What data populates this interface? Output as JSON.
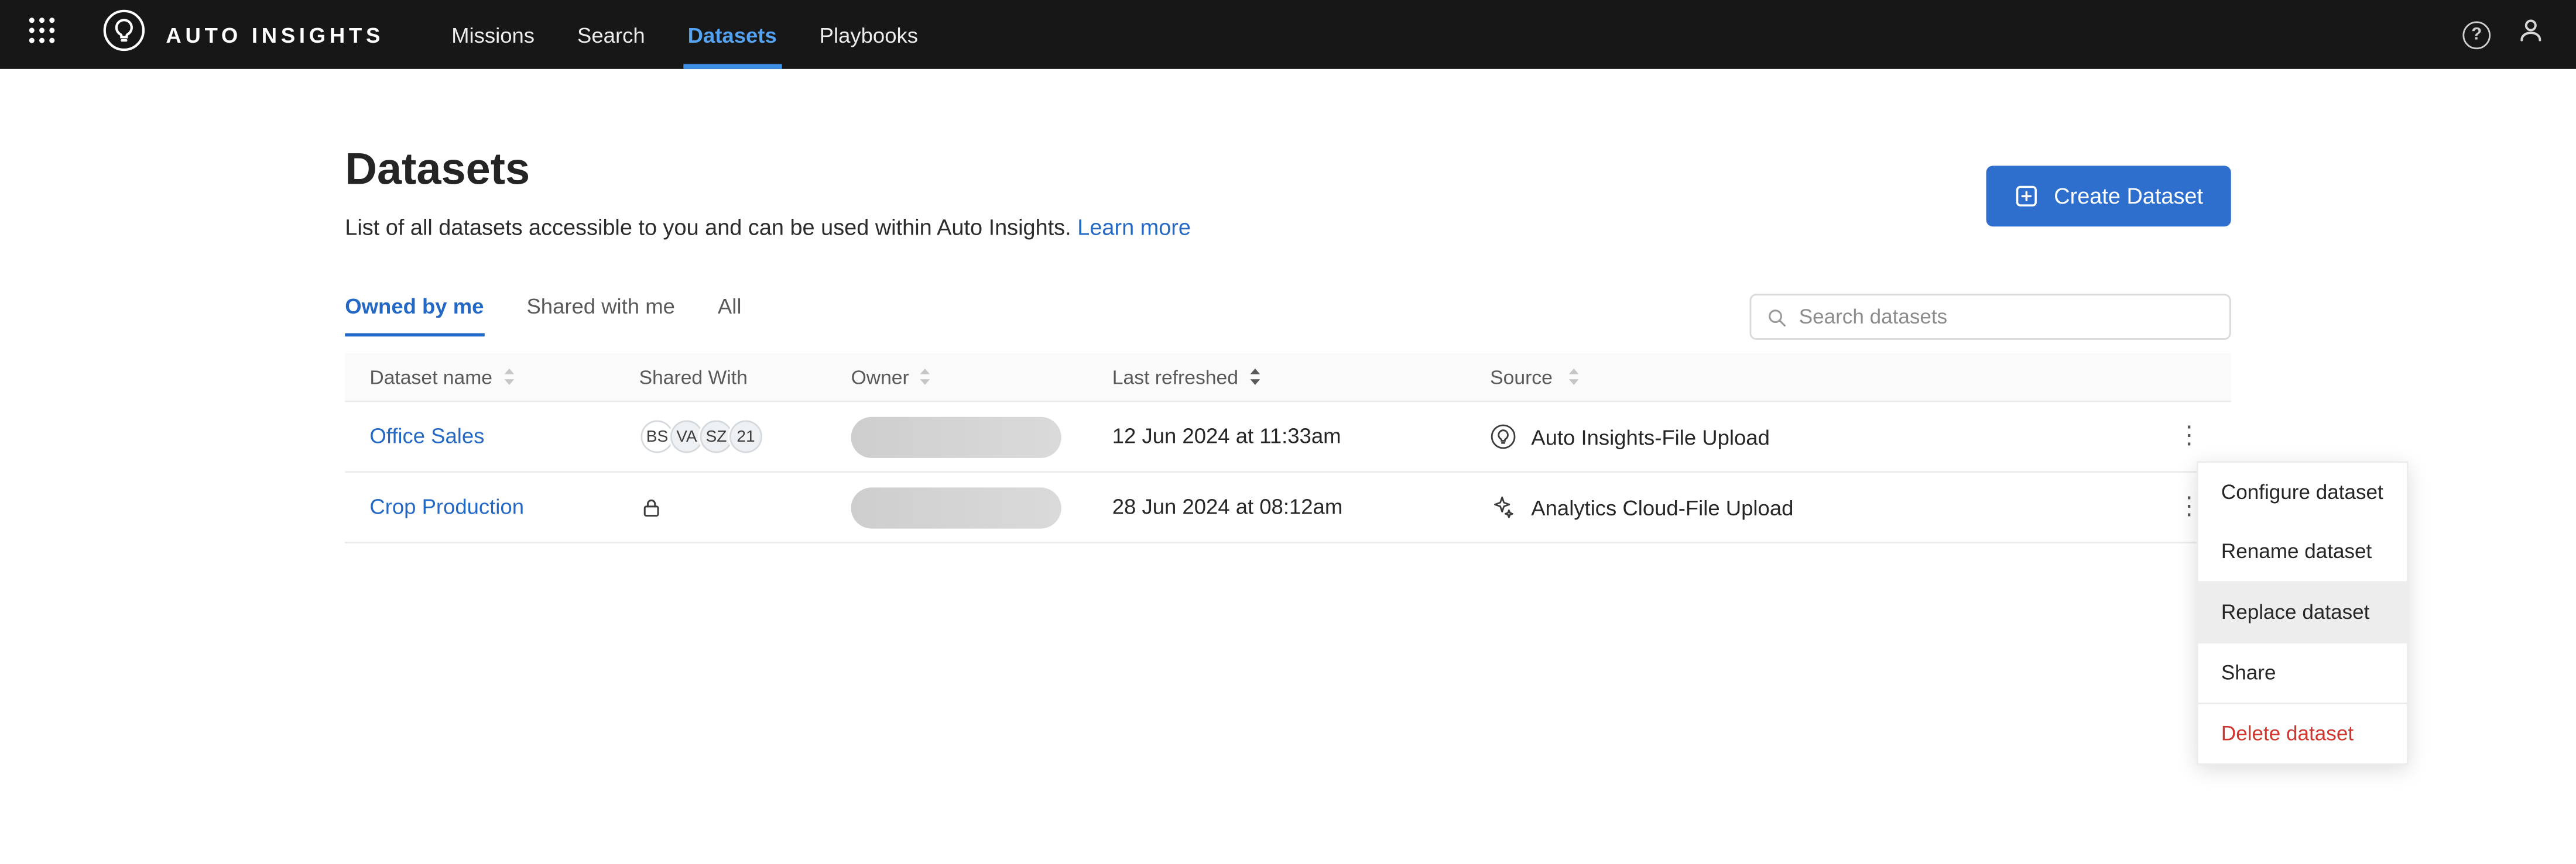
{
  "topbar": {
    "brand": "AUTO INSIGHTS",
    "nav": [
      {
        "label": "Missions",
        "active": false
      },
      {
        "label": "Search",
        "active": false
      },
      {
        "label": "Datasets",
        "active": true
      },
      {
        "label": "Playbooks",
        "active": false
      }
    ]
  },
  "header": {
    "title": "Datasets",
    "subtitle": "List of all datasets accessible to you and can be used within Auto Insights.",
    "learn_more": "Learn more",
    "create_button": "Create Dataset"
  },
  "tabs": [
    {
      "label": "Owned by me",
      "active": true
    },
    {
      "label": "Shared with me",
      "active": false
    },
    {
      "label": "All",
      "active": false
    }
  ],
  "search": {
    "placeholder": "Search datasets"
  },
  "table": {
    "columns": [
      "Dataset name",
      "Shared With",
      "Owner",
      "Last refreshed",
      "Source"
    ],
    "rows": [
      {
        "name": "Office Sales",
        "shared_with": {
          "type": "avatars",
          "avatars": [
            "BS",
            "VA",
            "SZ",
            "21"
          ]
        },
        "last_refreshed": "12 Jun 2024 at 11:33am",
        "source": "Auto Insights-File Upload",
        "source_icon": "auto-insights-icon"
      },
      {
        "name": "Crop Production",
        "shared_with": {
          "type": "lock"
        },
        "last_refreshed": "28 Jun 2024 at 08:12am",
        "source": "Analytics Cloud-File Upload",
        "source_icon": "analytics-cloud-icon"
      }
    ]
  },
  "context_menu": {
    "items": [
      {
        "label": "Configure dataset",
        "style": "normal"
      },
      {
        "label": "Rename dataset",
        "style": "normal"
      },
      {
        "label": "Replace dataset",
        "style": "highlight"
      },
      {
        "label": "Share",
        "style": "normal"
      },
      {
        "label": "Delete dataset",
        "style": "danger"
      }
    ]
  },
  "icons": {
    "kebab": "⋮",
    "help": "?"
  },
  "colors": {
    "topbar_bg": "#171717",
    "nav_active": "#55a2f0",
    "accent_blue": "#2368c4",
    "button_blue": "#2e6fce",
    "danger_red": "#d0342c",
    "header_row_bg": "#fafafa"
  }
}
